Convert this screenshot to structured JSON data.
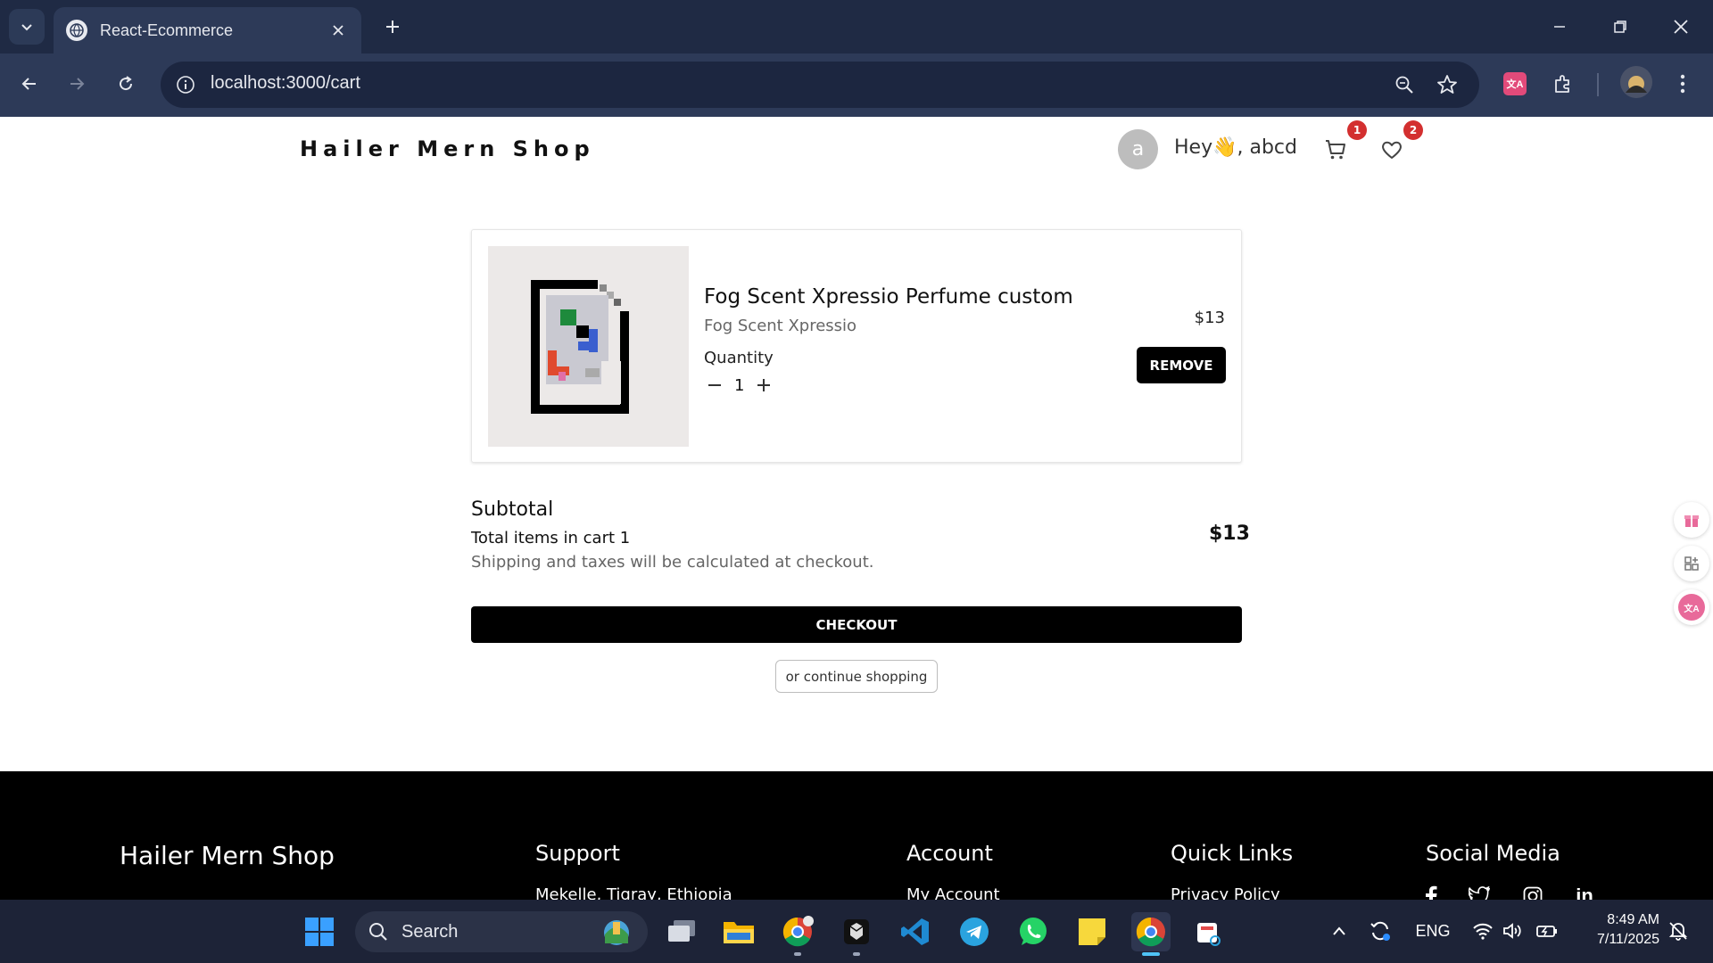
{
  "browser": {
    "tab_title": "React-Ecommerce",
    "url": "localhost:3000/cart"
  },
  "header": {
    "brand": "Hailer Mern Shop",
    "avatar_letter": "a",
    "greeting": "Hey👋, abcd",
    "cart_count": "1",
    "wishlist_count": "2"
  },
  "cart": {
    "items": [
      {
        "title": "Fog Scent Xpressio Perfume custom",
        "brand": "Fog Scent Xpressio",
        "quantity_label": "Quantity",
        "quantity": "1",
        "price": "$13",
        "remove_label": "REMOVE"
      }
    ],
    "subtotal_label": "Subtotal",
    "subtotal_value": "$13",
    "total_items_text": "Total items in cart 1",
    "shipping_note": "Shipping and taxes will be calculated at checkout.",
    "checkout_label": "CHECKOUT",
    "continue_label": "or continue shopping"
  },
  "footer": {
    "brand": "Hailer Mern Shop",
    "columns": [
      {
        "heading": "Support",
        "first_link": "Mekelle, Tigray, Ethiopia"
      },
      {
        "heading": "Account",
        "first_link": "My Account"
      },
      {
        "heading": "Quick Links",
        "first_link": "Privacy Policy"
      },
      {
        "heading": "Social Media"
      }
    ],
    "social_icons": [
      "facebook-icon",
      "twitter-icon",
      "instagram-icon",
      "linkedin-icon"
    ]
  },
  "taskbar": {
    "search_label": "Search",
    "language": "ENG",
    "time": "8:49 AM",
    "date": "7/11/2025"
  },
  "colors": {
    "browser_frame": "#1f2a44",
    "toolbar": "#2d3a58",
    "badge_red": "#d32f2f",
    "button_black": "#000000",
    "taskbar": "#1d2337"
  }
}
